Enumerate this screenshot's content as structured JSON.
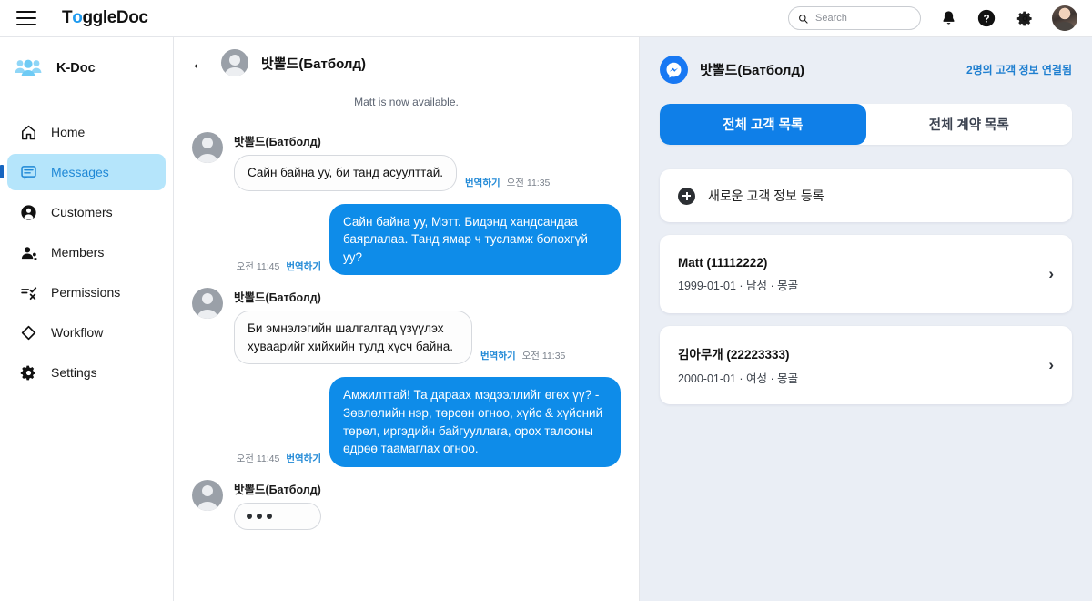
{
  "topbar": {
    "menu_icon": "hamburger-icon",
    "logo_part1": "T",
    "logo_o": "o",
    "logo_part2": "ggleDoc",
    "search_placeholder": "Search",
    "search_value": "",
    "search_icon": "search-icon",
    "bell_icon": "bell-icon",
    "help_icon": "help-icon",
    "gear_icon": "gear-icon",
    "avatar": "user-avatar"
  },
  "sidebar": {
    "brand_label": "K-Doc",
    "brand_icon": "group-people-icon",
    "items": [
      {
        "label": "Home",
        "icon": "home-icon",
        "active": false
      },
      {
        "label": "Messages",
        "icon": "message-icon",
        "active": true
      },
      {
        "label": "Customers",
        "icon": "person-circle-icon",
        "active": false
      },
      {
        "label": "Members",
        "icon": "people-icon",
        "active": false
      },
      {
        "label": "Permissions",
        "icon": "permissions-icon",
        "active": false
      },
      {
        "label": "Workflow",
        "icon": "diamond-icon",
        "active": false
      },
      {
        "label": "Settings",
        "icon": "gear-icon",
        "active": false
      }
    ]
  },
  "chat": {
    "back_icon": "back-arrow-icon",
    "header_name": "밧뽈드(Батболд)",
    "system_note": "Matt is now available.",
    "translate_label": "번역하기",
    "messages": [
      {
        "direction": "in",
        "sender": "밧뽈드(Батболд)",
        "text": "Сайн байна уу, би танд асуулттай.",
        "translate": "번역하기",
        "time": "오전 11:35"
      },
      {
        "direction": "out",
        "sender": "",
        "text": "Сайн байна уу, Мэтт. Бидэнд хандсандаа баярлалаа. Танд ямар ч тусламж болохгүй уу?",
        "translate": "번역하기",
        "time": "오전 11:45"
      },
      {
        "direction": "in",
        "sender": "밧뽈드(Батболд)",
        "text": "Би эмнэлэгийн шалгалтад үзүүлэх хуваарийг хийхийн тулд хүсч байна.",
        "translate": "번역하기",
        "time": "오전 11:35"
      },
      {
        "direction": "out",
        "sender": "",
        "text": "Амжилттай! Та дараах мэдээллийг өгөх үү? - Зөвлөлийн нэр, төрсөн огноо, хүйс & хүйсний төрөл, иргэдийн байгууллага, орох талооны өдрөө таамаглах огноо.",
        "translate": "번역하기",
        "time": "오전 11:45"
      }
    ],
    "typing_sender": "밧뽈드(Батболд)",
    "typing_indicator": "•••"
  },
  "panel": {
    "messenger_icon": "messenger-icon",
    "name": "밧뽈드(Батболд)",
    "link": "2명의 고객 정보 연결됨",
    "tabs": [
      {
        "label": "전체 고객 목록",
        "active": true
      },
      {
        "label": "전체 계약 목록",
        "active": false
      }
    ],
    "add_label": "새로운 고객 정보 등록",
    "add_icon": "plus-icon",
    "customers": [
      {
        "name": "Matt (11112222)",
        "sub": "1999-01-01 · 남성 · 몽골",
        "chevron": "›"
      },
      {
        "name": "김아무개 (22223333)",
        "sub": "2000-01-01 · 여성 · 몽골",
        "chevron": "›"
      }
    ]
  },
  "colors": {
    "accent_blue": "#0e8ce9",
    "tab_blue": "#0f7fe8",
    "active_nav_bg": "#b5e5fb",
    "active_nav_text": "#1f88d6",
    "panel_bg": "#eaeef5",
    "messenger_blue": "#1878f3"
  }
}
